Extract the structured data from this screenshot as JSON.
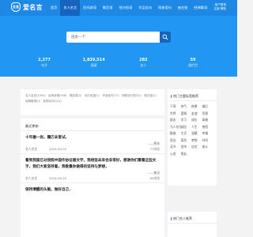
{
  "header": {
    "logo_mark": "名言",
    "logo_text": "爱名言",
    "nav": [
      "首页",
      "名人名言",
      "民间谚语",
      "歇后语",
      "地方俗语",
      "作品佳句",
      "网络语句",
      "座右铭",
      "经典歇语"
    ],
    "right_line1": "用户登录",
    "right_line2": "注册 帮助"
  },
  "search": {
    "placeholder": "搜索一下"
  },
  "stats": [
    {
      "num": "2,277",
      "label": "句子"
    },
    {
      "num": "1,839,514",
      "label": "阅读"
    },
    {
      "num": "282",
      "label": "名人"
    },
    {
      "num": "59",
      "label": "类栏目"
    }
  ],
  "categories": [
    "名人名言(1261)",
    "民间谚语(436)",
    "歇后语(2)",
    "地方俗语(1)",
    "作品佳句(71)",
    "网络流行语(32)",
    "座右铭(2)",
    "经典歇语(0)",
    "影视台词(124)"
  ],
  "list": {
    "title": "最近更新",
    "quotes": [
      {
        "text": "十年磨一剑，霜刃未曾试，",
        "author": "——贾岛",
        "category": "名人名言",
        "date": "2024-09-20",
        "likes": "77浏览"
      },
      {
        "text": "看到我国已对按照中国作协征展文学，我相信未来会非常好，感谢你们看看这些文字，我们大家坚持着，我敬重你做得的坚持与梦想，",
        "author": "——鲁迅",
        "category": "名人名言",
        "date": "2024-09-20",
        "likes": "60浏览"
      },
      {
        "text": "保持清醒的头脑，做好自己，",
        "author": "",
        "category": "",
        "date": "",
        "likes": ""
      }
    ]
  },
  "sidebar": {
    "hot_title": "热门主题标签推荐",
    "hot_tags": [
      "下雨",
      "亲气",
      "夜景",
      "婚后",
      "世界",
      "爱情",
      "友谊",
      "哲理",
      "励志",
      "学习",
      "成长",
      "青春",
      "为人处世",
      "诚信",
      "人生",
      "感悟",
      "勤奋",
      "生活",
      "温暖",
      "幸福",
      "思念",
      "离别",
      "梦想",
      "时间",
      "读书",
      "坚持",
      "自信",
      "奋斗",
      "心态",
      "朋友"
    ],
    "rec_title": "热门名人推荐"
  },
  "colors": {
    "primary": "#1e88e5",
    "hero": "#2196f3",
    "dark": "#1565c0"
  }
}
